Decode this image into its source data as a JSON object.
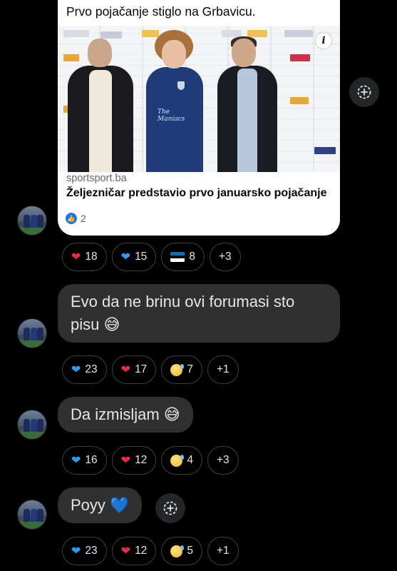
{
  "link_preview": {
    "headline": "Prvo pojačanje stiglo na Grbavicu.",
    "image_alt": "Three men posing in front of sponsor wall",
    "jersey_text": "The Maniacs",
    "domain": "sportsport.ba",
    "title": "Željezničar predstavio prvo januarsko pojačanje",
    "like_count": "2",
    "info_glyph": "i"
  },
  "messages": [
    {
      "text": "",
      "reactions": [
        {
          "emoji": "heart-red",
          "count": "18"
        },
        {
          "emoji": "heart-blue",
          "count": "15"
        },
        {
          "emoji": "flag-estonia",
          "count": "8"
        },
        {
          "emoji": "more",
          "count": "+3"
        }
      ]
    },
    {
      "text": "Evo da ne brinu ovi forumasi sto pisu 😅",
      "reactions": [
        {
          "emoji": "heart-blue",
          "count": "23"
        },
        {
          "emoji": "heart-red",
          "count": "17"
        },
        {
          "emoji": "grin-sweat",
          "count": "7"
        },
        {
          "emoji": "more",
          "count": "+1"
        }
      ]
    },
    {
      "text": "Da izmisljam 😅",
      "reactions": [
        {
          "emoji": "heart-blue",
          "count": "16"
        },
        {
          "emoji": "heart-red",
          "count": "12"
        },
        {
          "emoji": "grin-sweat",
          "count": "4"
        },
        {
          "emoji": "more",
          "count": "+3"
        }
      ]
    },
    {
      "text": "Poyy 💙",
      "reactions": [
        {
          "emoji": "heart-blue",
          "count": "23"
        },
        {
          "emoji": "heart-red",
          "count": "12"
        },
        {
          "emoji": "grin-sweat",
          "count": "5"
        },
        {
          "emoji": "more",
          "count": "+1"
        }
      ]
    }
  ],
  "colors": {
    "background": "#000000",
    "bubble": "#303030",
    "heart_red": "#f02849",
    "heart_blue": "#2a9df4",
    "like_blue": "#1877f2"
  },
  "icons": {
    "add_reaction": "add-reaction-icon",
    "like": "thumbs-up-icon"
  }
}
